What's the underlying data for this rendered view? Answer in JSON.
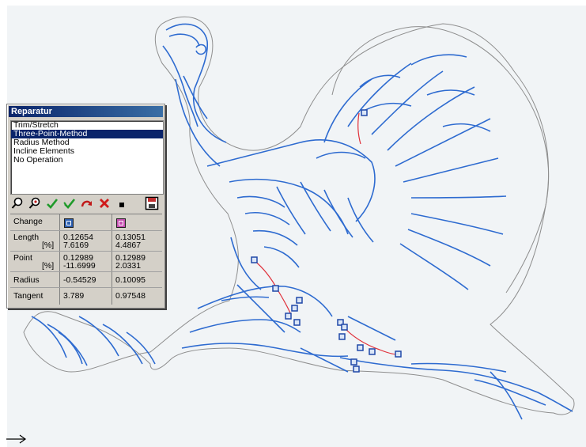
{
  "panel": {
    "title": "Reparatur",
    "operations": [
      {
        "label": "Trim/Stretch",
        "selected": false
      },
      {
        "label": "Three-Point-Method",
        "selected": true
      },
      {
        "label": "Radius Method",
        "selected": false
      },
      {
        "label": "Incline Elements",
        "selected": false
      },
      {
        "label": "No Operation",
        "selected": false
      }
    ],
    "toolbar": [
      {
        "icon": "zoom-icon"
      },
      {
        "icon": "zoom-point-icon"
      },
      {
        "icon": "check-green-icon"
      },
      {
        "icon": "check-double-icon"
      },
      {
        "icon": "redo-arc-icon"
      },
      {
        "icon": "cancel-x-icon"
      },
      {
        "icon": "stop-square-icon"
      },
      {
        "icon": "save-disk-icon"
      }
    ],
    "table": {
      "change_label": "Change",
      "col1_color": "#2d5fb0",
      "col2_color": "#c64fb1",
      "length_label": "Length",
      "length_pct_label": "[%]",
      "length_col1": "0.12654",
      "length_col1_pct": "7.6169",
      "length_col2": "0.13051",
      "length_col2_pct": "4.4867",
      "point_label": "Point",
      "point_pct_label": "[%]",
      "point_col1": "0.12989",
      "point_col1_pct": "-11.6999",
      "point_col2": "0.12989",
      "point_col2_pct": "2.0331",
      "radius_label": "Radius",
      "radius_col1": "-0.54529",
      "radius_col2": "0.10095",
      "tangent_label": "Tangent",
      "tangent_col1": "3.789",
      "tangent_col2": "0.97548"
    }
  },
  "colors": {
    "contour_blue": "#2e6bd0",
    "outline_gray": "#8e8e8e",
    "repair_red": "#e0303a",
    "canvas": "#f1f4f6"
  }
}
